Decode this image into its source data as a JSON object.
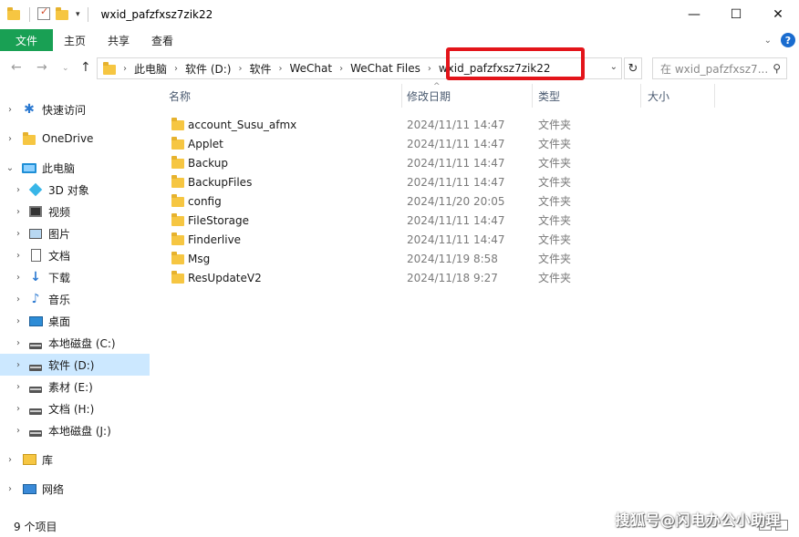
{
  "window": {
    "title": "wxid_pafzfxsz7zik22",
    "controls": {
      "minimize": "—",
      "maximize": "☐",
      "close": "✕"
    }
  },
  "ribbon": {
    "file_tab": "文件",
    "tabs": [
      "主页",
      "共享",
      "查看"
    ]
  },
  "address": {
    "crumbs": [
      "此电脑",
      "软件 (D:)",
      "软件",
      "WeChat",
      "WeChat Files",
      "wxid_pafzfxsz7zik22"
    ],
    "search_placeholder": "在 wxid_pafzfxsz7..."
  },
  "nav": {
    "items": [
      {
        "label": "快速访问",
        "icon": "star-icon"
      },
      {
        "label": "OneDrive",
        "icon": "folder-icon"
      },
      {
        "label": "此电脑",
        "icon": "pc-icon"
      },
      {
        "label": "3D 对象",
        "icon": "cube-icon"
      },
      {
        "label": "视频",
        "icon": "video-icon"
      },
      {
        "label": "图片",
        "icon": "picture-icon"
      },
      {
        "label": "文档",
        "icon": "document-icon"
      },
      {
        "label": "下载",
        "icon": "download-icon"
      },
      {
        "label": "音乐",
        "icon": "music-icon"
      },
      {
        "label": "桌面",
        "icon": "desktop-icon"
      },
      {
        "label": "本地磁盘 (C:)",
        "icon": "drive-icon"
      },
      {
        "label": "软件 (D:)",
        "icon": "drive-icon",
        "selected": true
      },
      {
        "label": "素材 (E:)",
        "icon": "drive-icon"
      },
      {
        "label": "文档 (H:)",
        "icon": "drive-icon"
      },
      {
        "label": "本地磁盘 (J:)",
        "icon": "drive-icon"
      },
      {
        "label": "库",
        "icon": "library-icon"
      },
      {
        "label": "网络",
        "icon": "network-icon"
      }
    ]
  },
  "columns": {
    "name": "名称",
    "date": "修改日期",
    "type": "类型",
    "size": "大小"
  },
  "files": [
    {
      "name": "account_Susu_afmx",
      "date": "2024/11/11 14:47",
      "type": "文件夹"
    },
    {
      "name": "Applet",
      "date": "2024/11/11 14:47",
      "type": "文件夹"
    },
    {
      "name": "Backup",
      "date": "2024/11/11 14:47",
      "type": "文件夹"
    },
    {
      "name": "BackupFiles",
      "date": "2024/11/11 14:47",
      "type": "文件夹"
    },
    {
      "name": "config",
      "date": "2024/11/20 20:05",
      "type": "文件夹"
    },
    {
      "name": "FileStorage",
      "date": "2024/11/11 14:47",
      "type": "文件夹"
    },
    {
      "name": "Finderlive",
      "date": "2024/11/11 14:47",
      "type": "文件夹"
    },
    {
      "name": "Msg",
      "date": "2024/11/19 8:58",
      "type": "文件夹"
    },
    {
      "name": "ResUpdateV2",
      "date": "2024/11/18 9:27",
      "type": "文件夹"
    }
  ],
  "status": {
    "count": "9 个项目"
  },
  "watermark": "搜狐号@闪电办公小助理",
  "colors": {
    "file_tab": "#19a054",
    "selection": "#cce8ff",
    "highlight": "#e3141a",
    "folder": "#f6c642"
  }
}
